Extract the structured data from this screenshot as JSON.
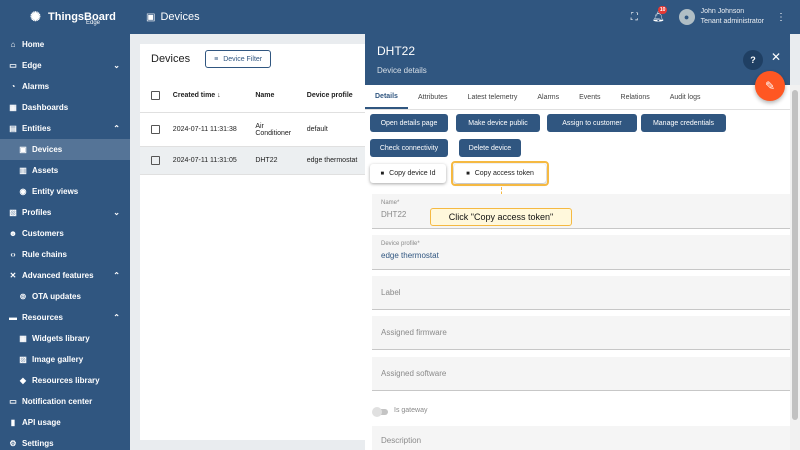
{
  "app": {
    "logo": "ThingsBoard",
    "logo_sub": "Edge",
    "page_title": "Devices"
  },
  "user": {
    "name": "John Johnson",
    "role": "Tenant administrator",
    "notifications_count": "10"
  },
  "sidebar": {
    "items": [
      {
        "label": "Home",
        "icon": "home-icon"
      },
      {
        "label": "Edge",
        "icon": "edge-icon"
      },
      {
        "label": "Alarms",
        "icon": "alarm-icon"
      },
      {
        "label": "Dashboards",
        "icon": "dashboard-icon"
      },
      {
        "label": "Entities",
        "icon": "entities-icon"
      },
      {
        "label": "Devices",
        "icon": "devices-icon"
      },
      {
        "label": "Assets",
        "icon": "assets-icon"
      },
      {
        "label": "Entity views",
        "icon": "entity-views-icon"
      },
      {
        "label": "Profiles",
        "icon": "profiles-icon"
      },
      {
        "label": "Customers",
        "icon": "customers-icon"
      },
      {
        "label": "Rule chains",
        "icon": "rule-chains-icon"
      },
      {
        "label": "Advanced features",
        "icon": "advanced-icon"
      },
      {
        "label": "OTA updates",
        "icon": "ota-icon"
      },
      {
        "label": "Resources",
        "icon": "resources-icon"
      },
      {
        "label": "Widgets library",
        "icon": "widgets-icon"
      },
      {
        "label": "Image gallery",
        "icon": "image-icon"
      },
      {
        "label": "Resources library",
        "icon": "library-icon"
      },
      {
        "label": "Notification center",
        "icon": "notification-icon"
      },
      {
        "label": "API usage",
        "icon": "api-icon"
      },
      {
        "label": "Settings",
        "icon": "settings-icon"
      }
    ]
  },
  "devices_list": {
    "title": "Devices",
    "filter_button": "Device Filter",
    "columns": [
      "Created time",
      "Name",
      "Device profile"
    ],
    "rows": [
      {
        "created": "2024-07-11 11:31:38",
        "name_line1": "Air",
        "name_line2": "Conditioner",
        "profile": "default"
      },
      {
        "created": "2024-07-11 11:31:05",
        "name": "DHT22",
        "profile": "edge thermostat"
      }
    ]
  },
  "details": {
    "title": "DHT22",
    "subtitle": "Device details",
    "tabs": [
      "Details",
      "Attributes",
      "Latest telemetry",
      "Alarms",
      "Events",
      "Relations",
      "Audit logs"
    ],
    "buttons": {
      "open_details": "Open details page",
      "make_public": "Make device public",
      "assign_customer": "Assign to customer",
      "manage_credentials": "Manage credentials",
      "check_connectivity": "Check connectivity",
      "delete_device": "Delete device",
      "copy_device_id": "Copy device Id",
      "copy_access_token": "Copy access token"
    },
    "callout": "Click \"Copy access token\"",
    "fields": {
      "name_label": "Name*",
      "name_value": "DHT22",
      "profile_label": "Device profile*",
      "profile_value": "edge thermostat",
      "label_placeholder": "Label",
      "firmware_placeholder": "Assigned firmware",
      "software_placeholder": "Assigned software",
      "gateway_label": "Is gateway",
      "description_placeholder": "Description"
    }
  },
  "colors": {
    "primary": "#305680",
    "accent": "#ff5722",
    "highlight": "#f5b942"
  }
}
